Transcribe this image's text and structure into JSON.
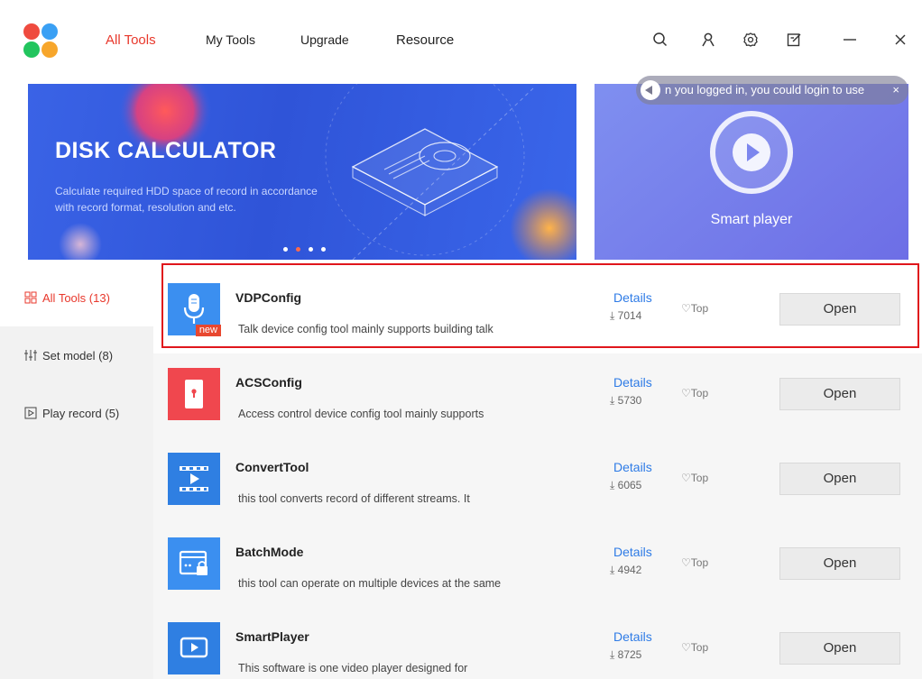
{
  "nav": {
    "tabs": [
      "All Tools",
      "My Tools",
      "Upgrade",
      "Resource"
    ]
  },
  "banner": {
    "title": "DISK CALCULATOR",
    "description": "Calculate required HDD space of record in accordance with record format, resolution and etc.",
    "side_label": "Smart player",
    "notice": "n you logged in, you could login to use",
    "notice_close": "×"
  },
  "sidebar": {
    "items": [
      {
        "label": "All Tools (13)",
        "icon": "grid-icon"
      },
      {
        "label": "Set model (8)",
        "icon": "sliders-icon"
      },
      {
        "label": "Play record (5)",
        "icon": "play-square-icon"
      }
    ]
  },
  "tools": [
    {
      "name": "VDPConfig",
      "description": "Talk device config tool mainly supports building talk",
      "details": "Details",
      "downloads": "7014",
      "top": "Top",
      "open": "Open",
      "badge": "new",
      "icon_color": "#3b8ff0"
    },
    {
      "name": "ACSConfig",
      "description": "Access control device config tool mainly supports",
      "details": "Details",
      "downloads": "5730",
      "top": "Top",
      "open": "Open",
      "icon_color": "#f0474e"
    },
    {
      "name": "ConvertTool",
      "description": "this tool converts record of different streams. It",
      "details": "Details",
      "downloads": "6065",
      "top": "Top",
      "open": "Open",
      "icon_color": "#2f7fe2"
    },
    {
      "name": "BatchMode",
      "description": "this tool can operate on multiple devices at the same",
      "details": "Details",
      "downloads": "4942",
      "top": "Top",
      "open": "Open",
      "icon_color": "#3b8ff0"
    },
    {
      "name": "SmartPlayer",
      "description": "This software is one video player designed for",
      "details": "Details",
      "downloads": "8725",
      "top": "Top",
      "open": "Open",
      "icon_color": "#2f7fe2"
    }
  ],
  "colors": {
    "accent": "#e8382c",
    "link": "#2e7be6",
    "highlight": "#e0161c"
  }
}
